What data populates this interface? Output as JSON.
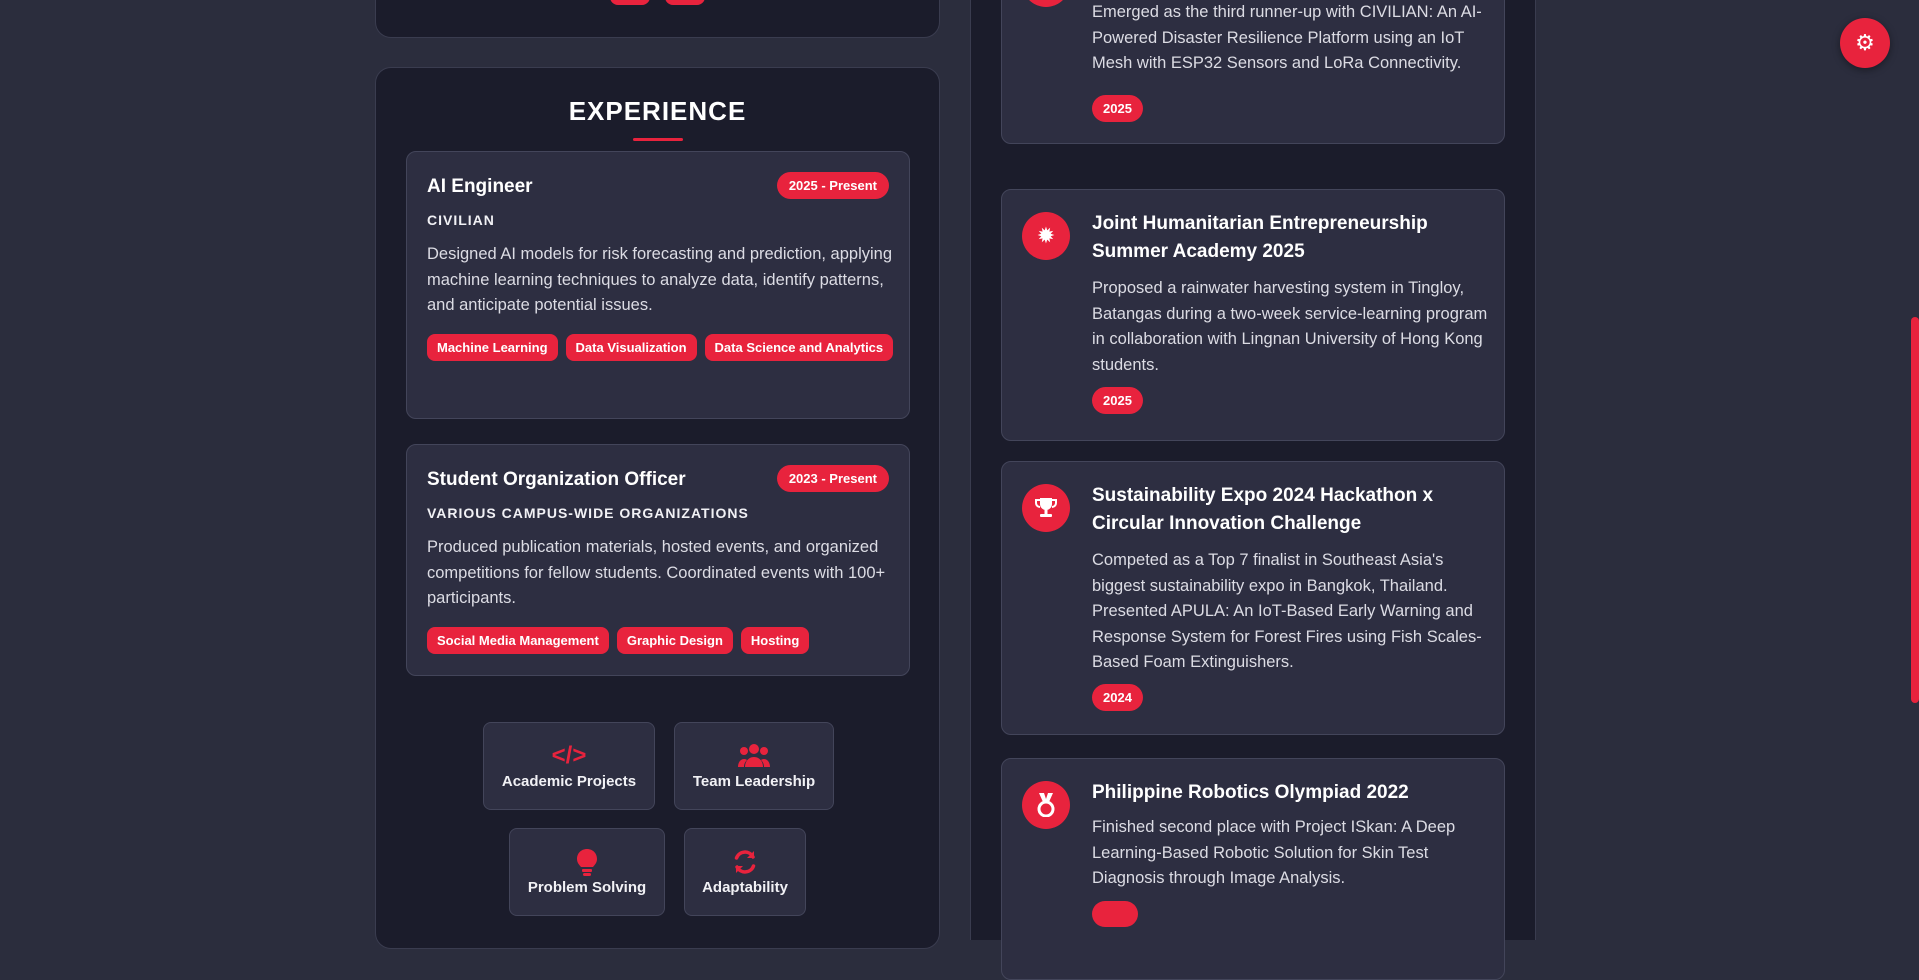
{
  "experience": {
    "title": "EXPERIENCE",
    "items": [
      {
        "title": "AI Engineer",
        "date": "2025 - Present",
        "org": "CIVILIAN",
        "description": "Designed AI models for risk forecasting and prediction, applying machine learning techniques to analyze data, identify patterns, and anticipate potential issues.",
        "tags": [
          "Machine Learning",
          "Data Visualization",
          "Data Science and Analytics"
        ]
      },
      {
        "title": "Student Organization Officer",
        "date": "2023 - Present",
        "org": "VARIOUS CAMPUS-WIDE ORGANIZATIONS",
        "description": "Produced publication materials, hosted events, and organized competitions for fellow students. Coordinated events with 100+ participants.",
        "tags": [
          "Social Media Management",
          "Graphic Design",
          "Hosting"
        ]
      }
    ],
    "skills": [
      {
        "label": "Academic Projects",
        "icon": "code-icon"
      },
      {
        "label": "Team Leadership",
        "icon": "users-icon"
      },
      {
        "label": "Problem Solving",
        "icon": "lightbulb-icon"
      },
      {
        "label": "Adaptability",
        "icon": "refresh-icon"
      }
    ]
  },
  "achievements": [
    {
      "title": "",
      "icon": "award-icon",
      "description": "Emerged as the third runner-up with CIVILIAN: An AI-Powered Disaster Resilience Platform using an IoT Mesh with ESP32 Sensors and LoRa Connectivity.",
      "year": "2025"
    },
    {
      "title": "Joint Humanitarian Entrepreneurship Summer Academy 2025",
      "icon": "certificate-icon",
      "description": "Proposed a rainwater harvesting system in Tingloy, Batangas during a two-week service-learning program in collaboration with Lingnan University of Hong Kong students.",
      "year": "2025"
    },
    {
      "title": "Sustainability Expo 2024 Hackathon x Circular Innovation Challenge",
      "icon": "trophy-icon",
      "description": "Competed as a Top 7 finalist in Southeast Asia's biggest sustainability expo in Bangkok, Thailand. Presented APULA: An IoT-Based Early Warning and Response System for Forest Fires using Fish Scales-Based Foam Extinguishers.",
      "year": "2024"
    },
    {
      "title": "Philippine Robotics Olympiad 2022",
      "icon": "medal-icon",
      "description": "Finished second place with Project ISkan: A Deep Learning-Based Robotic Solution for Skin Test Diagnosis through Image Analysis.",
      "year": ""
    }
  ],
  "theme_toggle": {
    "icon": "gear-icon"
  },
  "colors": {
    "accent": "#e8233d",
    "background": "#2b2d3d",
    "panel": "#1b1c2b",
    "card": "#2d2e41"
  }
}
